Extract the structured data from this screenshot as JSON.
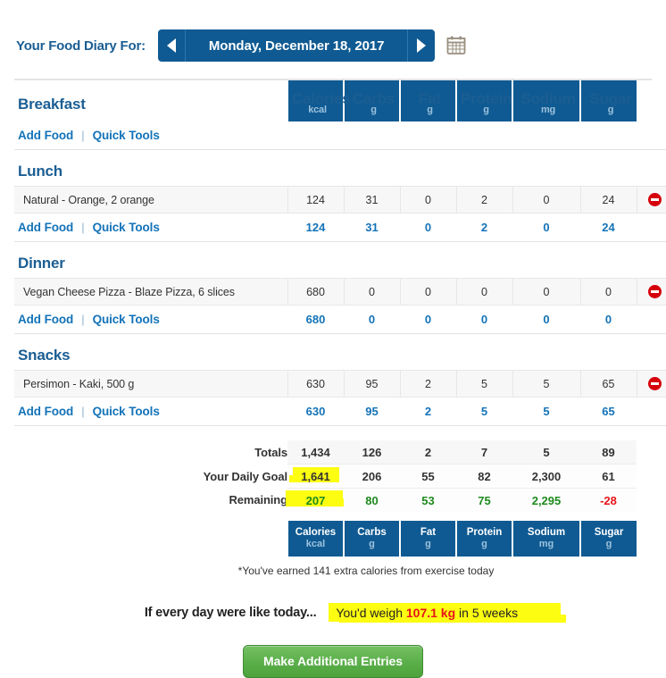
{
  "header": {
    "title": "Your Food Diary For:",
    "date": "Monday, December 18, 2017",
    "prev_icon": "triangle-left-icon",
    "next_icon": "triangle-right-icon",
    "calendar_icon": "calendar-icon"
  },
  "columns": [
    {
      "name": "Calories",
      "unit": "kcal"
    },
    {
      "name": "Carbs",
      "unit": "g"
    },
    {
      "name": "Fat",
      "unit": "g"
    },
    {
      "name": "Protein",
      "unit": "g"
    },
    {
      "name": "Sodium",
      "unit": "mg"
    },
    {
      "name": "Sugar",
      "unit": "g"
    }
  ],
  "links": {
    "add_food": "Add Food",
    "quick_tools": "Quick Tools",
    "separator": "|"
  },
  "meals": [
    {
      "name": "Breakfast",
      "items": [],
      "subtotal": [
        "",
        "",
        "",
        "",
        "",
        ""
      ]
    },
    {
      "name": "Lunch",
      "items": [
        {
          "label": "Natural - Orange, 2 orange",
          "values": [
            "124",
            "31",
            "0",
            "2",
            "0",
            "24"
          ],
          "delete_icon": "remove-circle-icon"
        }
      ],
      "subtotal": [
        "124",
        "31",
        "0",
        "2",
        "0",
        "24"
      ]
    },
    {
      "name": "Dinner",
      "items": [
        {
          "label": "Vegan Cheese Pizza - Blaze Pizza, 6 slices",
          "values": [
            "680",
            "0",
            "0",
            "0",
            "0",
            "0"
          ],
          "delete_icon": "remove-circle-icon"
        }
      ],
      "subtotal": [
        "680",
        "0",
        "0",
        "0",
        "0",
        "0"
      ]
    },
    {
      "name": "Snacks",
      "items": [
        {
          "label": "Persimon - Kaki, 500 g",
          "values": [
            "630",
            "95",
            "2",
            "5",
            "5",
            "65"
          ],
          "delete_icon": "remove-circle-icon"
        }
      ],
      "subtotal": [
        "630",
        "95",
        "2",
        "5",
        "5",
        "65"
      ]
    }
  ],
  "summary": {
    "totals_label": "Totals",
    "totals": [
      "1,434",
      "126",
      "2",
      "7",
      "5",
      "89"
    ],
    "goal_label": "Your Daily Goal",
    "goal": [
      "1,641",
      "206",
      "55",
      "82",
      "2,300",
      "61"
    ],
    "remaining_label": "Remaining",
    "remaining": [
      "207",
      "80",
      "53",
      "75",
      "2,295",
      "-28"
    ]
  },
  "footnote": "*You've earned 141 extra calories from exercise today",
  "projection": {
    "prefix": "If every day were like today...",
    "sentence_start": "You'd weigh ",
    "weight": "107.1 kg",
    "sentence_end": " in 5 weeks"
  },
  "cta": {
    "label": "Make Additional Entries"
  },
  "colors": {
    "brand_blue": "#0f5a92",
    "link_blue": "#1373b8",
    "green": "#1d8a1d",
    "red": "#e8131a",
    "highlight": "#fdfd12"
  }
}
